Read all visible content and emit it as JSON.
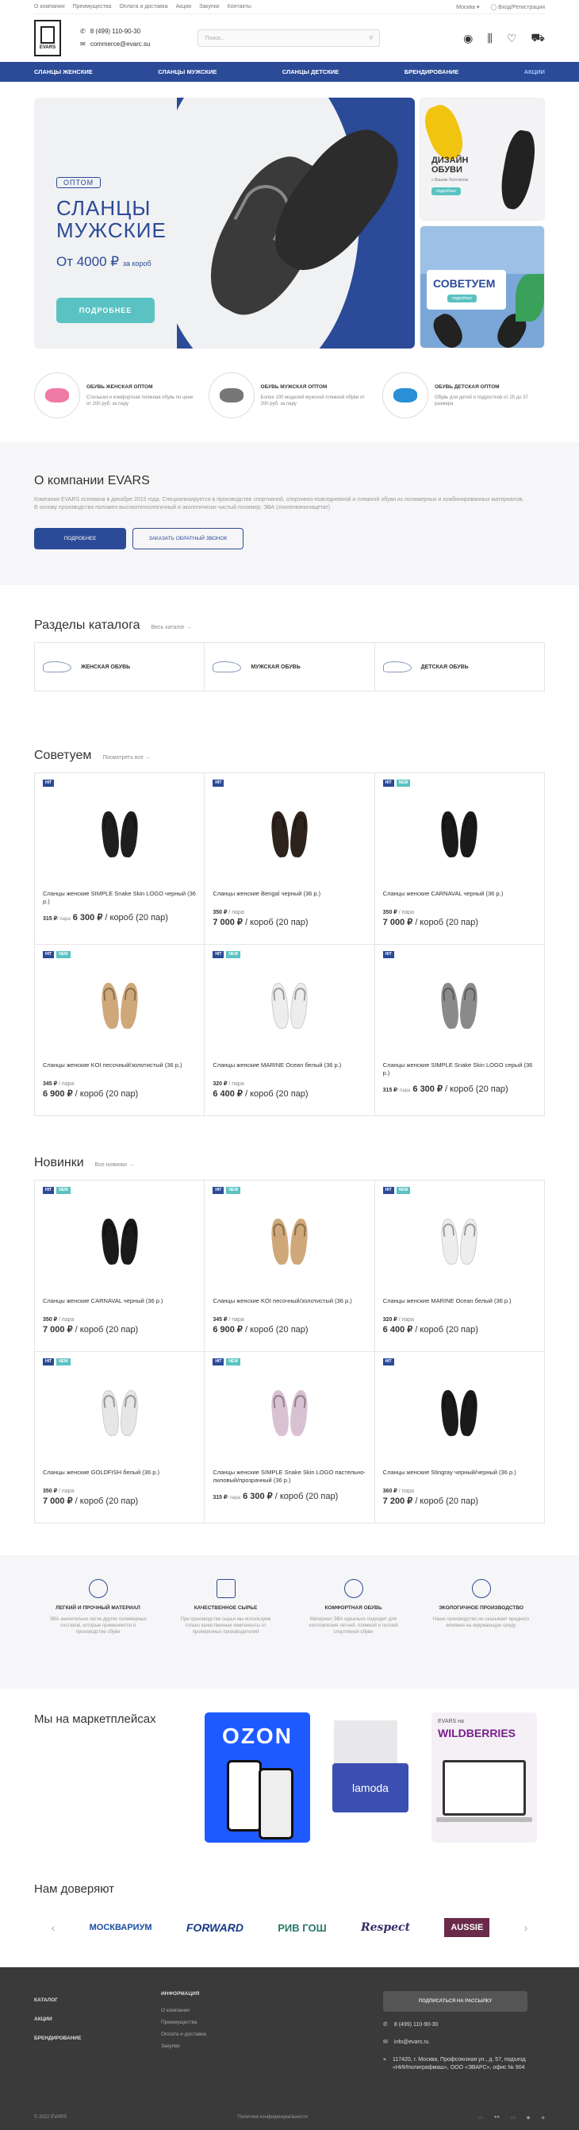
{
  "topbar": {
    "links": [
      "О компании",
      "Преимущества",
      "Оплата и доставка",
      "Акции",
      "Закупки",
      "Контакты"
    ],
    "city": "Москва",
    "login": "Вход/Регистрация"
  },
  "header": {
    "logo_text": "EVARS",
    "phone": "8 (499) 110-90-30",
    "email": "commerce@evarc.su",
    "search_placeholder": "Поиск..."
  },
  "nav": [
    "СЛАНЦЫ ЖЕНСКИЕ",
    "СЛАНЦЫ МУЖСКИЕ",
    "СЛАНЦЫ ДЕТСКИЕ",
    "БРЕНДИРОВАНИЕ",
    "АКЦИИ"
  ],
  "hero": {
    "badge": "ОПТОМ",
    "title_line1": "СЛАНЦЫ",
    "title_line2": "МУЖСКИЕ",
    "price": "От 4000 ₽",
    "price_unit": "за короб",
    "button": "ПОДРОБНЕЕ",
    "side1_title_1": "ДИЗАЙН",
    "side1_title_2": "ОБУВИ",
    "side1_sub": "с Вашим Логотипом",
    "side1_pill": "подробнее",
    "side2_title": "СОВЕТУЕМ",
    "side2_pill": "подробнее"
  },
  "features": [
    {
      "title": "ОБУВЬ ЖЕНСКАЯ ОПТОМ",
      "desc": "Стильная и комфортная пляжная обувь по цене от 200 руб. за пару",
      "color": "#f07aa6"
    },
    {
      "title": "ОБУВЬ МУЖСКАЯ ОПТОМ",
      "desc": "Более 100 моделей мужской пляжной обуви от 200 руб. за пару",
      "color": "#777777"
    },
    {
      "title": "ОБУВЬ ДЕТСКАЯ ОПТОМ",
      "desc": "Обувь для детей и подростков от 25 до 37 размера",
      "color": "#2a8fd6"
    }
  ],
  "about": {
    "title": "О компании EVARS",
    "text": "Компания EVARS основана в декабре 2015 года. Специализируется в производстве спортивной, спортивно-повседневной и пляжной обуви из полимерных и комбинированных материалов. В основу производства положен высокотехнологичный и экологически чистый полимер, ЭВА (этиленвинилацетат)",
    "btn_more": "ПОДРОБНЕЕ",
    "btn_call": "ЗАКАЗАТЬ ОБРАТНЫЙ ЗВОНОК"
  },
  "catalog": {
    "title": "Разделы каталога",
    "all": "Весь каталог →",
    "items": [
      "ЖЕНСКАЯ ОБУВЬ",
      "МУЖСКАЯ ОБУВЬ",
      "ДЕТСКАЯ ОБУВЬ"
    ]
  },
  "recommended": {
    "title": "Советуем",
    "all": "Посмотреть все →",
    "products": [
      {
        "name": "Сланцы женские SIMPLE Snake Skin LOGO черный (36 р.)",
        "pair": "315 ₽",
        "pair_unit": "/ пара",
        "box": "6 300 ₽",
        "box_unit": "/ короб (20 пар)",
        "hit": "HIT",
        "new": "",
        "color": "#1e1e1e",
        "inline": true
      },
      {
        "name": "Сланцы женские Bengal черный (36 р.)",
        "pair": "350 ₽",
        "pair_unit": "/ пара",
        "box": "7 000 ₽",
        "box_unit": "/ короб (20 пар)",
        "hit": "HIT",
        "new": "",
        "color": "#2d221c",
        "inline": false
      },
      {
        "name": "Сланцы женские CARNAVAL черный (36 р.)",
        "pair": "350 ₽",
        "pair_unit": "/ пара",
        "box": "7 000 ₽",
        "box_unit": "/ короб (20 пар)",
        "hit": "HIT",
        "new": "NEW",
        "color": "#1a1a1a",
        "inline": false
      },
      {
        "name": "Сланцы женские KOI песочный/золотистый (36 р.)",
        "pair": "345 ₽",
        "pair_unit": "/ пара",
        "box": "6 900 ₽",
        "box_unit": "/ короб (20 пар)",
        "hit": "HIT",
        "new": "NEW",
        "color": "#cfa87a",
        "inline": false
      },
      {
        "name": "Сланцы женские MARINE Ocean белый (36 р.)",
        "pair": "320 ₽",
        "pair_unit": "/ пара",
        "box": "6 400 ₽",
        "box_unit": "/ короб (20 пар)",
        "hit": "HIT",
        "new": "NEW",
        "color": "#ededed",
        "inline": false
      },
      {
        "name": "Сланцы женские SIMPLE Snake Skin LOGO серый (36 р.)",
        "pair": "315 ₽",
        "pair_unit": "/ пара",
        "box": "6 300 ₽",
        "box_unit": "/ короб (20 пар)",
        "hit": "HIT",
        "new": "",
        "color": "#8a8a8a",
        "inline": true
      }
    ]
  },
  "novelties": {
    "title": "Новинки",
    "all": "Все новинки →",
    "products": [
      {
        "name": "Сланцы женские CARNAVAL черный (36 р.)",
        "pair": "350 ₽",
        "pair_unit": "/ пара",
        "box": "7 000 ₽",
        "box_unit": "/ короб (20 пар)",
        "hit": "HIT",
        "new": "NEW",
        "color": "#1a1a1a",
        "inline": false
      },
      {
        "name": "Сланцы женские KOI песочный/золотистый (36 р.)",
        "pair": "345 ₽",
        "pair_unit": "/ пара",
        "box": "6 900 ₽",
        "box_unit": "/ короб (20 пар)",
        "hit": "HIT",
        "new": "NEW",
        "color": "#cfa87a",
        "inline": false
      },
      {
        "name": "Сланцы женские MARINE Ocean белый (36 р.)",
        "pair": "320 ₽",
        "pair_unit": "/ пара",
        "box": "6 400 ₽",
        "box_unit": "/ короб (20 пар)",
        "hit": "HIT",
        "new": "NEW",
        "color": "#ededed",
        "inline": false
      },
      {
        "name": "Сланцы женские GOLDFISH белый (36 р.)",
        "pair": "350 ₽",
        "pair_unit": "/ пара",
        "box": "7 000 ₽",
        "box_unit": "/ короб (20 пар)",
        "hit": "HIT",
        "new": "NEW",
        "color": "#e6e6e6",
        "inline": false
      },
      {
        "name": "Сланцы женские SIMPLE Snake Skin LOGO пастельно-лиловый/прозрачный (36 р.)",
        "pair": "315 ₽",
        "pair_unit": "/ пара",
        "box": "6 300 ₽",
        "box_unit": "/ короб (20 пар)",
        "hit": "HIT",
        "new": "NEW",
        "color": "#d8c2d2",
        "inline": true
      },
      {
        "name": "Сланцы женские Stingray черный/черный (36 р.)",
        "pair": "360 ₽",
        "pair_unit": "/ пара",
        "box": "7 200 ₽",
        "box_unit": "/ короб (20 пар)",
        "hit": "HIT",
        "new": "",
        "color": "#1a1a1a",
        "inline": false
      }
    ]
  },
  "benefits": [
    {
      "title": "ЛЕГКИЙ И ПРОЧНЫЙ МАТЕРИАЛ",
      "desc": "ЭВА значительно легче других полимерных составов, которые применяются в производстве обуви"
    },
    {
      "title": "КАЧЕСТВЕННОЕ СЫРЬЕ",
      "desc": "При производстве сырья мы используем только качественные компоненты от проверенных производителей"
    },
    {
      "title": "КОМФОРТНАЯ ОБУВЬ",
      "desc": "Материал ЭВА идеально подходит для изготовления летней, пляжной и полной спортивной обуви"
    },
    {
      "title": "ЭКОЛОГИЧНОЕ ПРОИЗВОДСТВО",
      "desc": "Наше производство не оказывает вредного влияния на окружающую среду"
    }
  ],
  "markets": {
    "title": "Мы на маркетплейсах",
    "ozon": "OZON",
    "lamoda": "lamoda",
    "wb_top": "EVARS на",
    "wb": "WILDBERRIES"
  },
  "trust": {
    "title": "Нам доверяют",
    "brands": [
      {
        "name": "МОСКВАРИУМ",
        "color": "#1a4fa0"
      },
      {
        "name": "FORWARD",
        "color": "#1a3a8a"
      },
      {
        "name": "РИВ ГОШ",
        "color": "#2a7a6a"
      },
      {
        "name": "Respect",
        "color": "#3a2a6a"
      },
      {
        "name": "AUSSIE",
        "color": "#6a2a4a"
      }
    ]
  },
  "footer": {
    "col1": [
      "КАТАЛОГ",
      "АКЦИИ",
      "БРЕНДИРОВАНИЕ"
    ],
    "info_title": "ИНФОРМАЦИЯ",
    "info_links": [
      "О компании",
      "Преимущества",
      "Оплата и доставка",
      "Закупки"
    ],
    "subscribe": "ПОДПИСАТЬСЯ НА РАССЫЛКУ",
    "phone": "8 (499) 110-90-30",
    "email": "info@evars.ru",
    "address": "117420, г. Москва, Профсоюзная ул., д. 57, подъезд «НИИполиграфмаш», ООО «ЭВАРС», офис № 904",
    "copyright": "© 2022 EVARS",
    "policy": "Политика конфиденциальности"
  }
}
